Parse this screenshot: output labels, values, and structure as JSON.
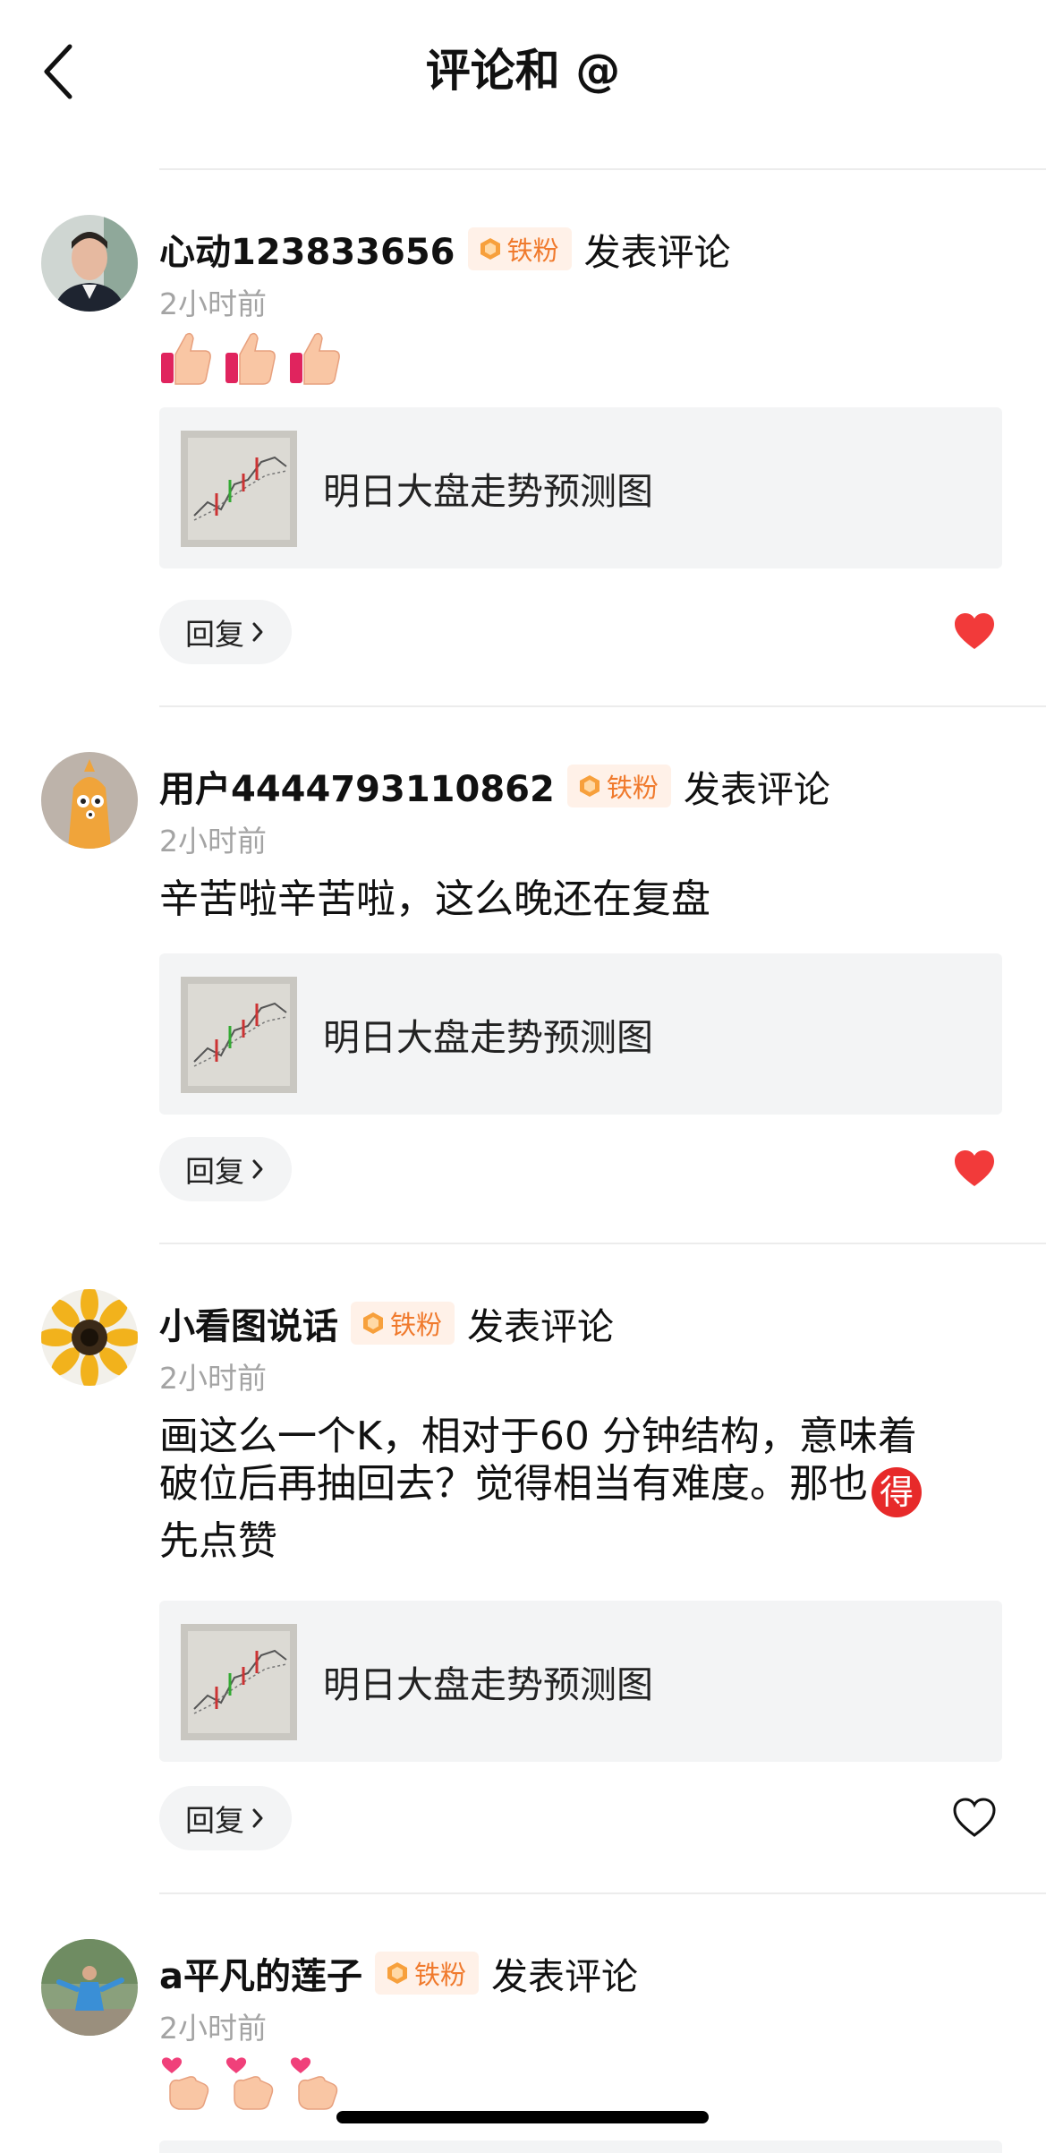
{
  "header": {
    "title": "评论和 @",
    "back_icon": "chevron-left-icon"
  },
  "colors": {
    "badge_bg": "#fff1e8",
    "badge_text": "#f07a2d",
    "like_active": "#f23a3a",
    "timestamp": "#a4a4a4",
    "card_bg": "#f3f4f5"
  },
  "comments": [
    {
      "username": "心动123833656",
      "badge": "铁粉",
      "action": "发表评论",
      "time": "2小时前",
      "content_emojis": [
        "thumbs-up-icon",
        "thumbs-up-icon",
        "thumbs-up-icon"
      ],
      "post_title": "明日大盘走势预测图",
      "reply_label": "回复",
      "liked": true
    },
    {
      "username": "用户4444793110862",
      "badge": "铁粉",
      "action": "发表评论",
      "time": "2小时前",
      "text": "辛苦啦辛苦啦，这么晚还在复盘",
      "post_title": "明日大盘走势预测图",
      "reply_label": "回复",
      "liked": true
    },
    {
      "username": "小看图说话",
      "badge": "铁粉",
      "action": "发表评论",
      "time": "2小时前",
      "text_line1": "画这么一个K，相对于60 分钟结构，意味着",
      "text_line2": "破位后再抽回去？觉得相当有难度。那也",
      "inline_emoji": "得",
      "text_line3": "先点赞",
      "post_title": "明日大盘走势预测图",
      "reply_label": "回复",
      "liked": false
    },
    {
      "username": "a平凡的莲子",
      "badge": "铁粉",
      "action": "发表评论",
      "time": "2小时前",
      "content_emojis": [
        "finger-heart-icon",
        "finger-heart-icon",
        "finger-heart-icon"
      ]
    }
  ]
}
